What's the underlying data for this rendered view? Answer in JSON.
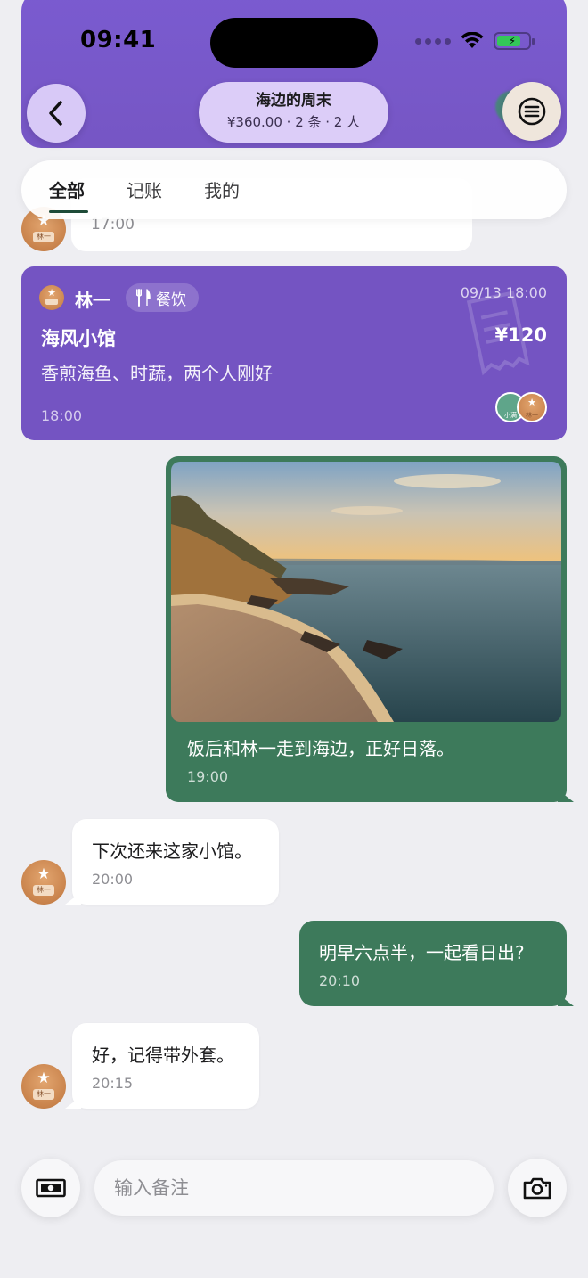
{
  "status_bar": {
    "time": "09:41"
  },
  "header": {
    "title": "海边的周末",
    "subtitle": "¥360.00 · 2 条 · 2 人"
  },
  "tabs": [
    {
      "label": "全部",
      "active": true
    },
    {
      "label": "记账",
      "active": false
    },
    {
      "label": "我的",
      "active": false
    }
  ],
  "messages": {
    "hidden": {
      "time": "17:00"
    },
    "expense": {
      "payer": "林一",
      "category": "餐饮",
      "date": "09/13 18:00",
      "title": "海风小馆",
      "amount": "¥120",
      "description": "香煎海鱼、时蔬，两个人刚好",
      "time": "18:00",
      "participants": [
        "小满",
        "林一"
      ]
    },
    "photo": {
      "caption": "饭后和林一走到海边，正好日落。",
      "time": "19:00"
    },
    "m1": {
      "text": "下次还来这家小馆。",
      "time": "20:00"
    },
    "m2": {
      "text": "明早六点半，一起看日出?",
      "time": "20:10"
    },
    "m3": {
      "text": "好，记得带外套。",
      "time": "20:15"
    }
  },
  "avatar_tag": "林一",
  "input": {
    "placeholder": "输入备注"
  },
  "colors": {
    "purple_card": "#7454c2",
    "green_bubble": "#3d7a5b",
    "background": "#eeeef2"
  }
}
